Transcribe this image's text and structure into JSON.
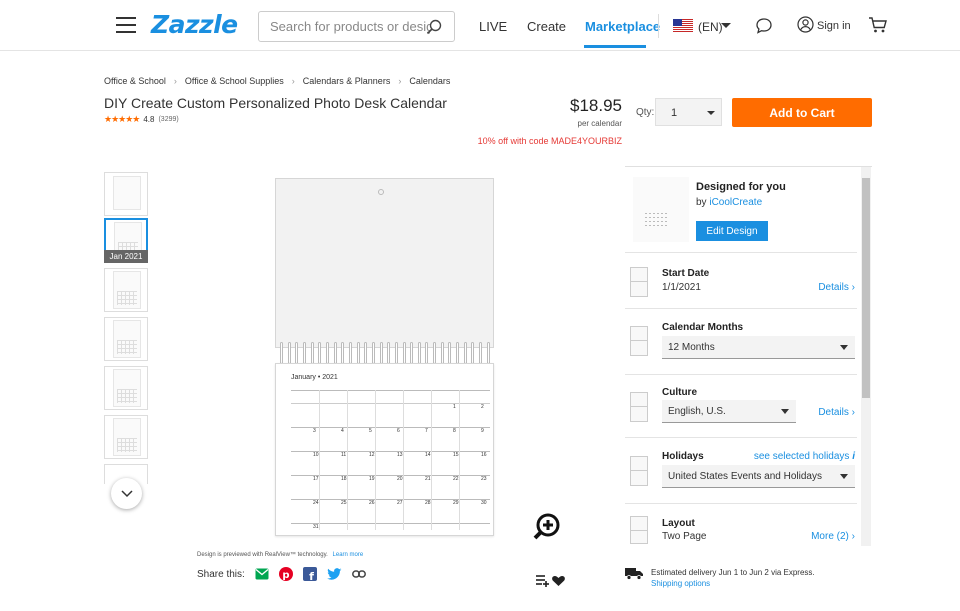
{
  "header": {
    "logo": "Zazzle",
    "search_placeholder": "Search for products or designs",
    "nav": {
      "live": "LIVE",
      "create": "Create",
      "marketplace": "Marketplace"
    },
    "language": "(EN)",
    "sign_in": "Sign in"
  },
  "breadcrumb": [
    "Office & School",
    "Office & School Supplies",
    "Calendars & Planners",
    "Calendars"
  ],
  "product": {
    "title": "DIY Create Custom Personalized Photo Desk Calendar",
    "rating": "4.8",
    "review_count": "(3299)",
    "rating_value": 4.8,
    "price": "$18.95",
    "per": "per calendar",
    "promo": "10% off with code MADE4YOURBIZ"
  },
  "purchase": {
    "qty_label": "Qty:",
    "qty_value": "1",
    "add_to_cart": "Add to Cart"
  },
  "thumbnails": {
    "selected_label": "Jan 2021"
  },
  "preview": {
    "calendar_month": "January  •  2021",
    "realview_text": "Design is previewed with RealView™ technology.",
    "learn_more": "Learn more",
    "share_label": "Share this:"
  },
  "options": {
    "designed_for": "Designed for you",
    "by": "by",
    "designer": "iCoolCreate",
    "edit_design": "Edit Design",
    "start_date": {
      "title": "Start Date",
      "value": "1/1/2021",
      "link": "Details ›"
    },
    "months": {
      "title": "Calendar Months",
      "value": "12 Months"
    },
    "culture": {
      "title": "Culture",
      "value": "English, U.S.",
      "link": "Details ›"
    },
    "holidays": {
      "title": "Holidays",
      "link": "see selected holidays",
      "value": "United States Events and Holidays"
    },
    "layout": {
      "title": "Layout",
      "value": "Two Page",
      "link": "More (2) ›"
    }
  },
  "delivery": {
    "text": "Estimated delivery Jun 1 to Jun 2 via Express.",
    "shipping": "Shipping options"
  },
  "colors": {
    "brand": "#1a8fe0",
    "cta": "#ff6c00",
    "promo": "#e53935"
  }
}
